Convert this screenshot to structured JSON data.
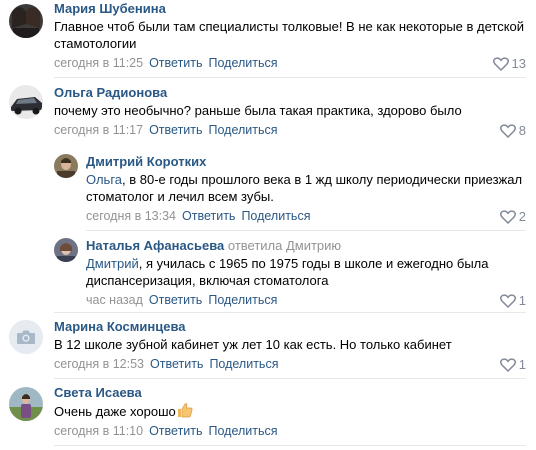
{
  "comments": [
    {
      "author": "Мария Шубенина",
      "text": "Главное чтоб были там специалисты толковые! В не как некоторые в детской стамотологии",
      "time": "сегодня в 11:25",
      "reply": "Ответить",
      "share": "Поделиться",
      "likes": "13",
      "avatar": "photo-avatar-two-women"
    },
    {
      "author": "Ольга Радионова",
      "text": "почему это необычно? раньше была такая практика, здорово было",
      "time": "сегодня в 11:17",
      "reply": "Ответить",
      "share": "Поделиться",
      "likes": "8",
      "avatar": "photo-avatar-car"
    },
    {
      "author": "Дмитрий Коротких",
      "mention": "Ольга",
      "text": ", в 80-е годы прошлого века в 1 жд школу периодически приезжал стоматолог и лечил всем зубы.",
      "time": "сегодня в 13:34",
      "reply": "Ответить",
      "share": "Поделиться",
      "likes": "2",
      "avatar": "photo-avatar-man"
    },
    {
      "author": "Наталья Афанасьева",
      "replied_to": "ответила Дмитрию",
      "mention": "Дмитрий",
      "text": ", я училась с 1965 по 1975 годы в школе и ежегодно была диспансеризация, включая стоматолога",
      "time": "час назад",
      "reply": "Ответить",
      "share": "Поделиться",
      "likes": "1",
      "avatar": "photo-avatar-woman"
    },
    {
      "author": "Марина Косминцева",
      "text": "В 12 школе зубной кабинет уж лет 10 как есть. Но только кабинет",
      "time": "сегодня в 12:53",
      "reply": "Ответить",
      "share": "Поделиться",
      "likes": "1",
      "avatar": "camera-placeholder-icon"
    },
    {
      "author": "Света Исаева",
      "text": "Очень даже хорошо",
      "emoji": "thumbs-up-emoji",
      "time": "сегодня в 11:10",
      "reply": "Ответить",
      "share": "Поделиться",
      "avatar": "photo-avatar-woman-outdoors"
    }
  ],
  "colors": {
    "link": "#2a5885",
    "meta": "#939393",
    "like": "#828a99",
    "separator": "#e7e8ec"
  }
}
